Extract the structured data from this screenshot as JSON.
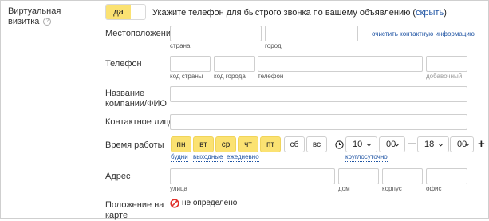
{
  "section": {
    "title": "Виртуальная визитка",
    "help": "?"
  },
  "toggle": {
    "on_label": "да"
  },
  "hint": {
    "text": "Укажите телефон для быстрого звонка по вашему объявлению",
    "open_paren": "(",
    "link": "скрыть",
    "close_paren": ")"
  },
  "location": {
    "label": "Местоположение",
    "country": "страна",
    "city": "город",
    "clear_link": "очистить контактную информацию"
  },
  "phone": {
    "label": "Телефон",
    "country_code": "код страны",
    "city_code": "код города",
    "number": "телефон",
    "extension": "добавочный"
  },
  "company": {
    "label_line1": "Название",
    "label_line2": "компании/ФИО"
  },
  "contact": {
    "label": "Контактное лицо"
  },
  "hours": {
    "label": "Время работы",
    "days": [
      {
        "label": "пн",
        "selected": true
      },
      {
        "label": "вт",
        "selected": true
      },
      {
        "label": "ср",
        "selected": true
      },
      {
        "label": "чт",
        "selected": true
      },
      {
        "label": "пт",
        "selected": true
      },
      {
        "label": "сб",
        "selected": false
      },
      {
        "label": "вс",
        "selected": false
      }
    ],
    "presets": [
      "будни",
      "выходные",
      "ежедневно"
    ],
    "from_hour": "10",
    "from_min": "00",
    "dash": "—",
    "to_hour": "18",
    "to_min": "00",
    "round_clock": "круглосуточно",
    "add": "+"
  },
  "address": {
    "label": "Адрес",
    "street": "улица",
    "house": "дом",
    "building": "корпус",
    "office": "офис"
  },
  "map": {
    "label_line1": "Положение на",
    "label_line2": "карте",
    "status": "не определено"
  },
  "colors": {
    "accent": "#fbe272",
    "link": "#1e53a3",
    "error": "#e0302a"
  }
}
